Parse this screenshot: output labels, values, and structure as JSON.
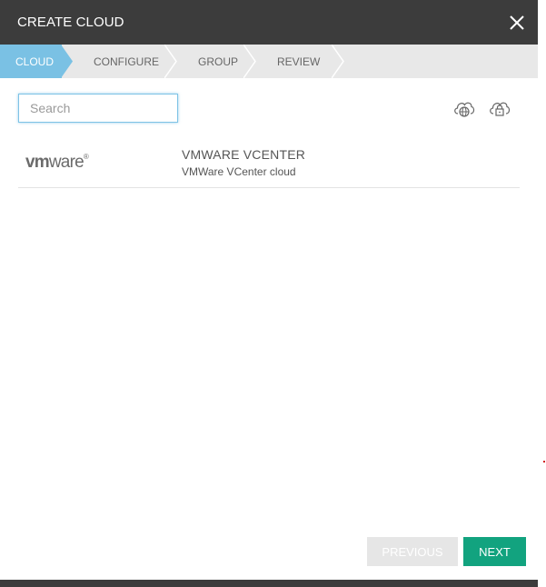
{
  "dialog": {
    "title": "CREATE CLOUD",
    "close_icon": "close-icon"
  },
  "steps": [
    {
      "label": "CLOUD",
      "active": true
    },
    {
      "label": "CONFIGURE",
      "active": false
    },
    {
      "label": "GROUP",
      "active": false
    },
    {
      "label": "REVIEW",
      "active": false
    }
  ],
  "search": {
    "value": "",
    "placeholder": "Search"
  },
  "toolbar_icons": [
    "cloud-globe-icon",
    "cloud-lock-icon"
  ],
  "clouds": [
    {
      "logo_text_bold": "vm",
      "logo_text": "ware",
      "logo_mark": "®",
      "title": "VMWARE VCENTER",
      "description": "VMWare VCenter cloud"
    }
  ],
  "footer": {
    "previous_label": "PREVIOUS",
    "next_label": "NEXT"
  },
  "colors": {
    "header_bg": "#3c3c3c",
    "active_step": "#7ac1e4",
    "steps_bg": "#e8e8e8",
    "next_button": "#12a37f",
    "previous_button_disabled": "#e6e6e6"
  }
}
